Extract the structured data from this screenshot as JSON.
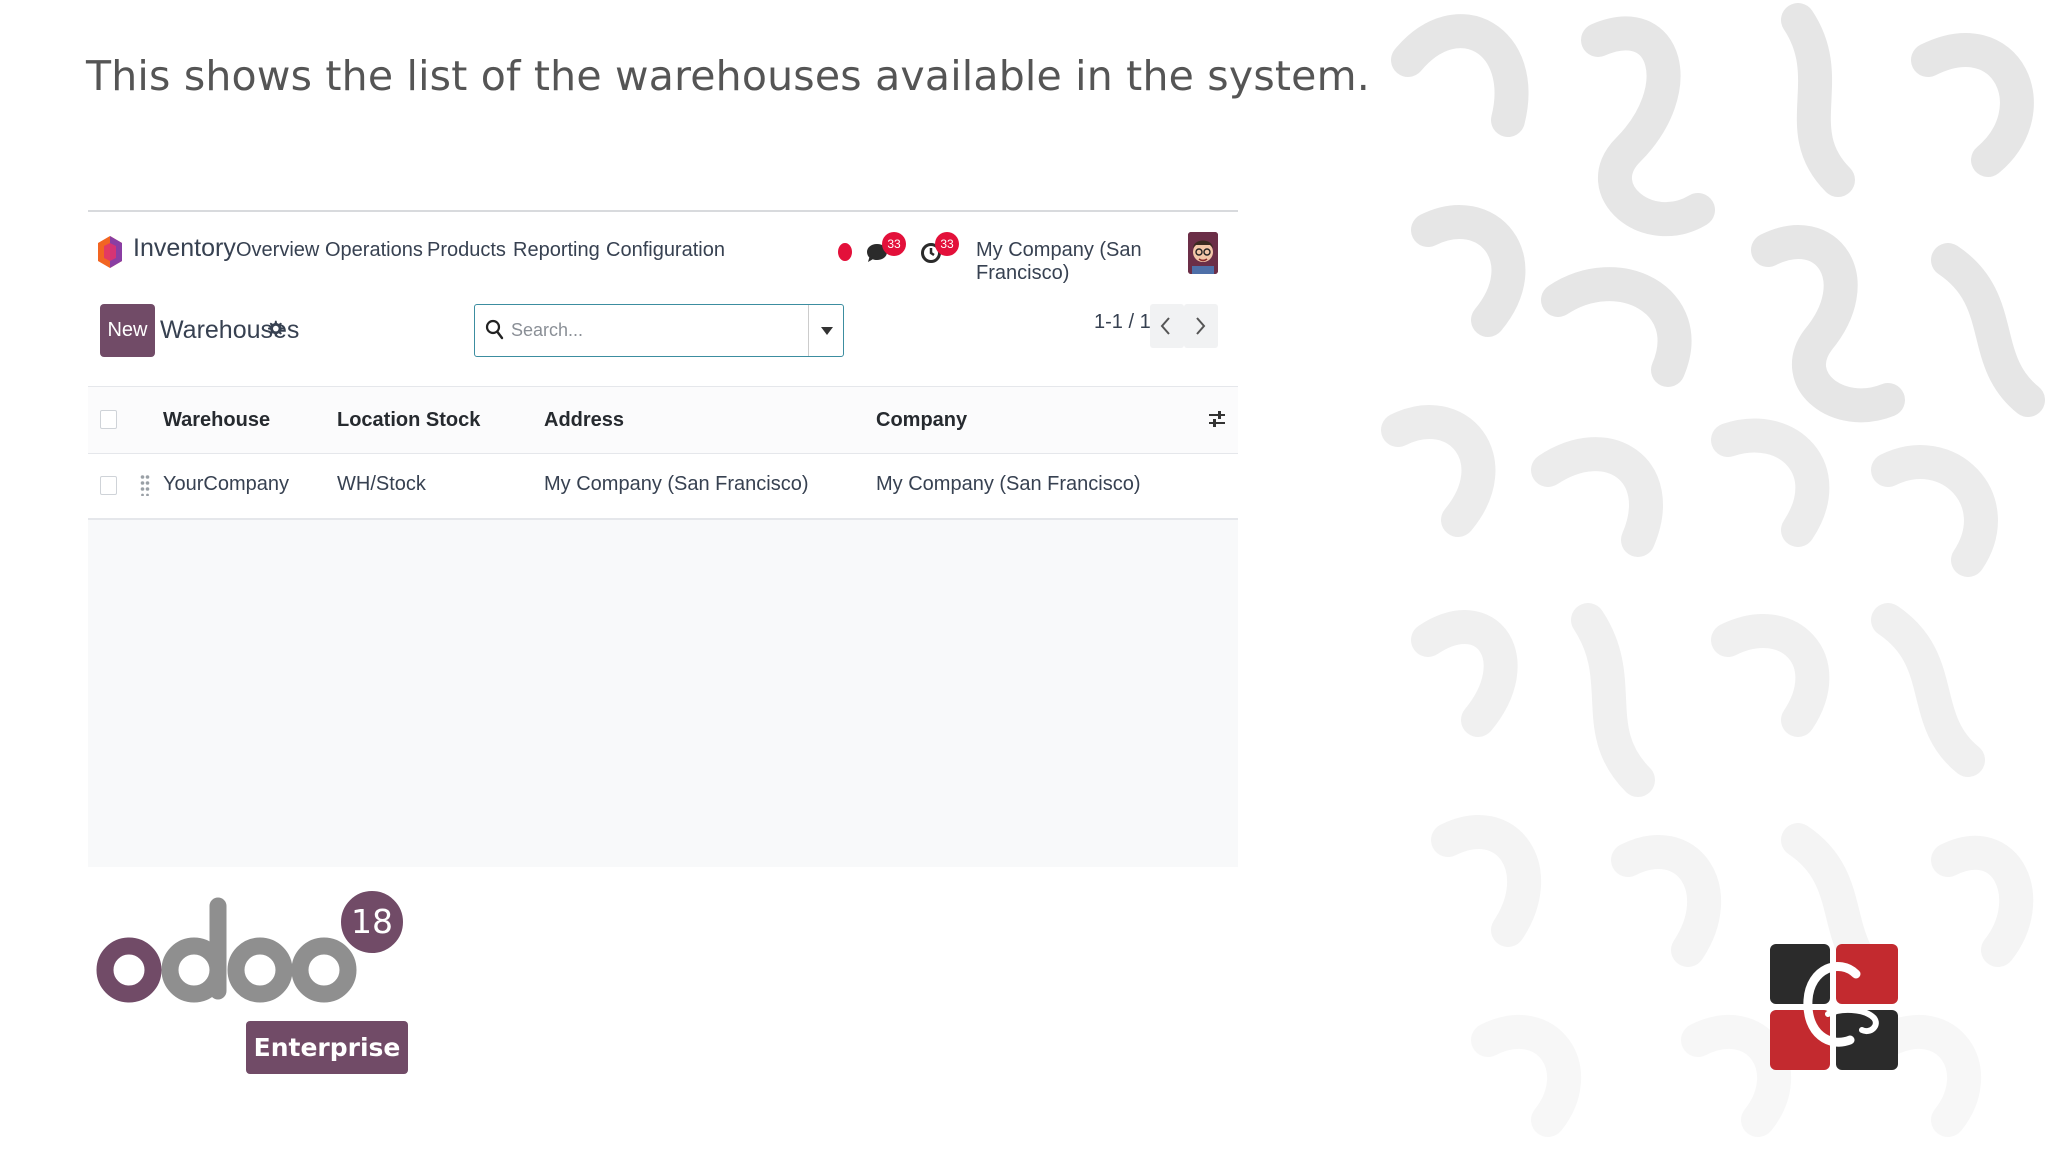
{
  "caption": "This shows the list of the warehouses available in the system.",
  "navbar": {
    "app_name": "Inventory",
    "menu": [
      "Overview",
      "Operations",
      "Products",
      "Reporting",
      "Configuration"
    ],
    "messages_badge": "33",
    "activities_badge": "33",
    "company": "My Company (San Francisco)"
  },
  "control": {
    "new_label": "New",
    "page_title": "Warehouses",
    "search_placeholder": "Search...",
    "pager": "1-1 / 1"
  },
  "table": {
    "columns": [
      "Warehouse",
      "Location Stock",
      "Address",
      "Company"
    ],
    "rows": [
      [
        "YourCompany",
        "WH/Stock",
        "My Company (San Francisco)",
        "My Company (San Francisco)"
      ]
    ]
  },
  "branding": {
    "version": "18",
    "edition": "Enterprise",
    "logo_text": "odoo"
  },
  "colors": {
    "primary": "#714b67",
    "badge": "#e3103a",
    "brand_red": "#c32a2f",
    "brand_dark": "#2b2b2b"
  }
}
